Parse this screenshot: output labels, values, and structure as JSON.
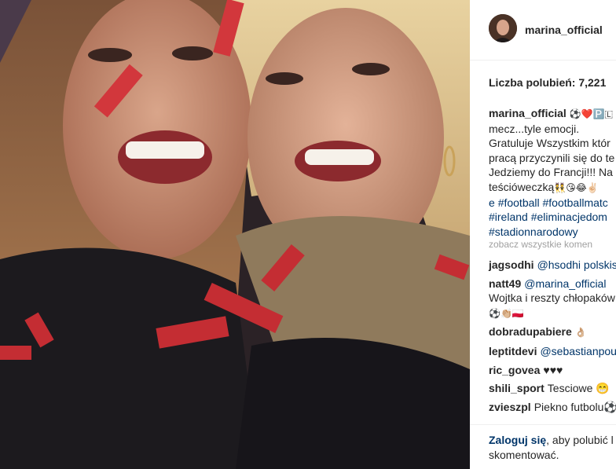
{
  "post": {
    "username": "marina_official",
    "likes_text": "Liczba polubień: 7,221",
    "caption_user": "marina_official",
    "caption_emoji_1": "⚽❤️🅿️🇱",
    "caption_lines": [
      "mecz...tyle emocji.",
      "Gratuluje Wszystkim któr",
      "pracą przyczynili się do te",
      "Jedziemy do Francji!!! Na",
      "teścióweczką"
    ],
    "caption_emoji_2": "👯😘😂✌🏻",
    "hashtag_lines": [
      "#football #footballmatc",
      "#ireland #eliminacjedom",
      "#stadionnarodowy"
    ],
    "hashtag_prefix": "e",
    "view_all": "zobacz wszystkie komen",
    "comments": [
      {
        "user": "jagsodhi",
        "text": "@hsodhi polskis"
      },
      {
        "user": "natt49",
        "text": "@marina_official ",
        "extra_line": "Wojtka i reszty chłopaków",
        "extra_emoji": "⚽👏🏼🇵🇱"
      },
      {
        "user": "dobradupabiere",
        "text": "👌🏼"
      },
      {
        "user": "leptitdevi",
        "text": "@sebastianpou"
      },
      {
        "user": "ric_govea",
        "text": "♥♥♥"
      },
      {
        "user": "shili_sport",
        "text": "Tesciowe 😁"
      },
      {
        "user": "zvieszpl",
        "text": "Piekno futbolu⚽"
      }
    ],
    "footer_login": "Zaloguj się",
    "footer_rest_1": ", aby polubić l",
    "footer_rest_2": "skomentować."
  }
}
